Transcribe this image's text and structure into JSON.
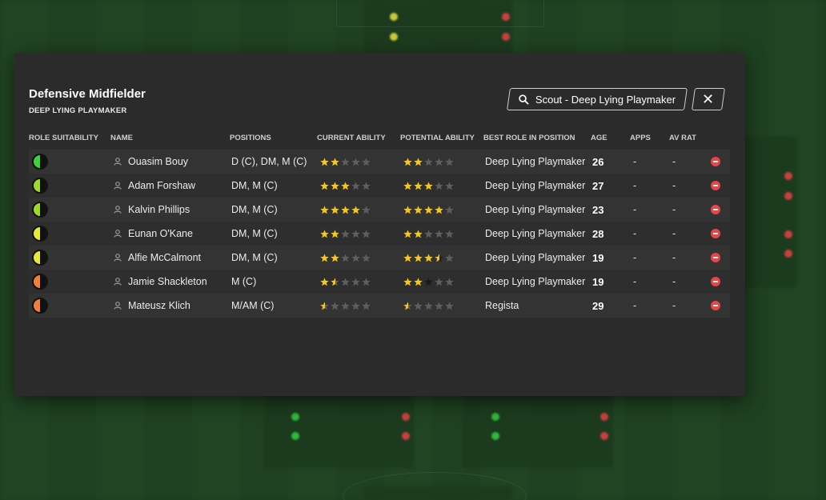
{
  "modal": {
    "title": "Defensive Midfielder",
    "subtitle": "DEEP LYING PLAYMAKER",
    "scout_button_label": "Scout - Deep Lying Playmaker"
  },
  "columns": {
    "role_suitability": "ROLE SUITABILITY",
    "name": "NAME",
    "positions": "POSITIONS",
    "current_ability": "CURRENT ABILITY",
    "potential_ability": "POTENTIAL ABILITY",
    "best_role": "BEST ROLE IN POSITION",
    "age": "AGE",
    "apps": "APPS",
    "av_rat": "AV RAT"
  },
  "colors": {
    "suit_green": "#3fd23f",
    "suit_lime": "#9ed82a",
    "suit_yellow": "#e8e83a",
    "suit_orange": "#f0803c",
    "star_gold": "#f5c518",
    "star_grey": "#5e5e5e",
    "remove_red": "#e94547"
  },
  "players": [
    {
      "suitability": "suit_green",
      "name": "Ouasim Bouy",
      "positions": "D (C), DM, M (C)",
      "ca": 2,
      "pa": 2,
      "role": "Deep Lying Playmaker",
      "age": "26",
      "apps": "-",
      "av_rat": "-"
    },
    {
      "suitability": "suit_lime",
      "name": "Adam Forshaw",
      "positions": "DM, M (C)",
      "ca": 3,
      "pa": 3,
      "role": "Deep Lying Playmaker",
      "age": "27",
      "apps": "-",
      "av_rat": "-"
    },
    {
      "suitability": "suit_lime",
      "name": "Kalvin Phillips",
      "positions": "DM, M (C)",
      "ca": 4,
      "pa": 4,
      "role": "Deep Lying Playmaker",
      "age": "23",
      "apps": "-",
      "av_rat": "-"
    },
    {
      "suitability": "suit_yellow",
      "name": "Eunan O'Kane",
      "positions": "DM, M (C)",
      "ca": 2,
      "pa": 2,
      "role": "Deep Lying Playmaker",
      "age": "28",
      "apps": "-",
      "av_rat": "-"
    },
    {
      "suitability": "suit_yellow",
      "name": "Alfie McCalmont",
      "positions": "DM, M (C)",
      "ca": 2,
      "pa": 3.5,
      "pa_range": 4,
      "role": "Deep Lying Playmaker",
      "age": "19",
      "apps": "-",
      "av_rat": "-"
    },
    {
      "suitability": "suit_orange",
      "name": "Jamie Shackleton",
      "positions": "M (C)",
      "ca": 1.5,
      "pa": 2,
      "pa_range": 3,
      "role": "Deep Lying Playmaker",
      "age": "19",
      "apps": "-",
      "av_rat": "-"
    },
    {
      "suitability": "suit_orange",
      "name": "Mateusz Klich",
      "positions": "M/AM (C)",
      "ca": 0.5,
      "pa": 0.5,
      "role": "Regista",
      "age": "29",
      "apps": "-",
      "av_rat": "-"
    }
  ]
}
